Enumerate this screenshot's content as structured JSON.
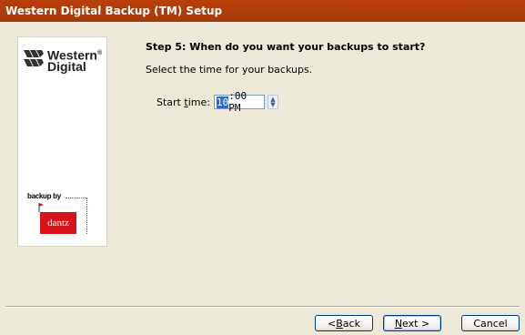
{
  "window": {
    "title": "Western Digital Backup (TM) Setup"
  },
  "branding": {
    "wd_logo_line1": "Western",
    "wd_logo_reg": "®",
    "wd_logo_line2": "Digital",
    "backupby_label": "backup by",
    "dantz_label": "dantz"
  },
  "step": {
    "title": "Step 5: When do you want your backups to start?",
    "instruction": "Select the time for your backups."
  },
  "start_time": {
    "label_pre": "Start ",
    "label_accel": "t",
    "label_post": "ime:",
    "hour": "10",
    "rest": ":00 PM"
  },
  "buttons": {
    "back_pre": "< ",
    "back_accel": "B",
    "back_post": "ack",
    "next_accel": "N",
    "next_post": "ext >",
    "cancel": "Cancel"
  },
  "colors": {
    "titlebar": "#A43A0B",
    "dantz_red": "#D7141A",
    "selection": "#316AC5"
  }
}
